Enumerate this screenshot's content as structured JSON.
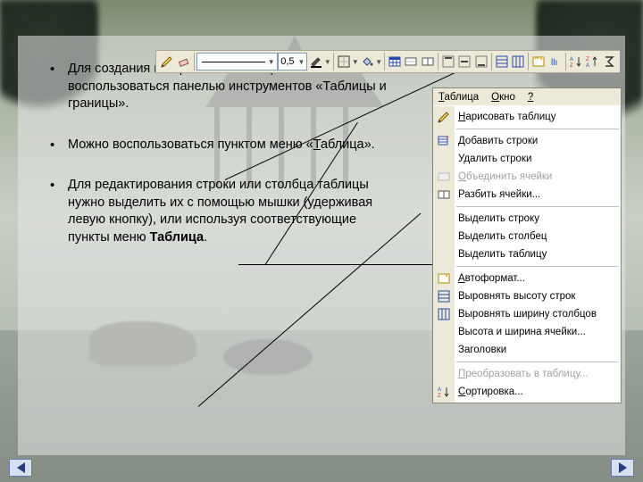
{
  "bullets": {
    "b1_pre": "Для создания и обработки таблиц можно воспользоваться панелью инструментов «Таблицы и границы».",
    "b2_pre": "Можно воспользоваться пунктом меню «",
    "b2_under": "Т",
    "b2_post": "аблица».",
    "b3_pre": "Для редактирования строки или столбца таблицы нужно выделить их с помощью мышки (удерживая левую кнопку), или используя соответствующие пункты меню ",
    "b3_bold": "Таблица",
    "b3_end": "."
  },
  "toolbar": {
    "line_weight": "0,5"
  },
  "menubar": {
    "table_u": "Т",
    "table_r": "аблица",
    "window_u": "О",
    "window_r": "кно",
    "help_u": "?"
  },
  "menu": {
    "draw_u": "Н",
    "draw_r": "арисовать таблицу",
    "insrows_u": "Д",
    "insrows_r": "обавить строки",
    "delrows": "Удалить строки",
    "merge_u": "О",
    "merge_r": "бъединить ячейки",
    "split": "Разбить ячейки...",
    "selrow": "Выделить строку",
    "selcol": "Выделить столбец",
    "seltab": "Выделить таблицу",
    "autofmt_u": "А",
    "autofmt_r": "втоформат...",
    "distrows": "Выровнять высоту строк",
    "distcols": "Выровнять ширину столбцов",
    "cellhw": "Высота и ширина ячейки...",
    "headings": "Заголовки",
    "convert_u": "П",
    "convert_r": "реобразовать в таблицу...",
    "sort_u": "С",
    "sort_r": "ортировка..."
  }
}
